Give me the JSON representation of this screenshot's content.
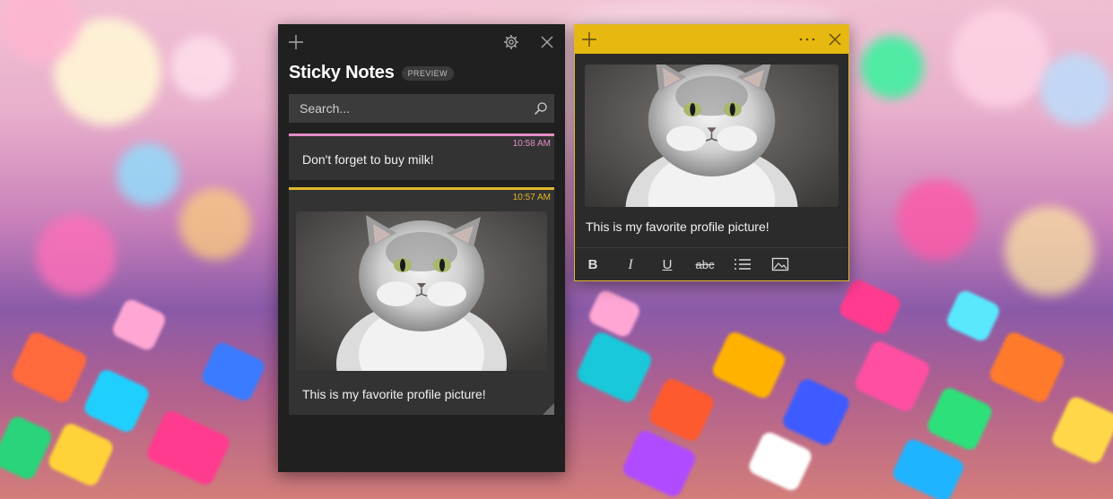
{
  "list_window": {
    "app_title": "Sticky Notes",
    "preview_badge": "PREVIEW",
    "search": {
      "placeholder": "Search..."
    },
    "notes": [
      {
        "time": "10:58 AM",
        "text": "Don't forget to buy milk!",
        "color": "#e58cc6"
      },
      {
        "time": "10:57 AM",
        "text": "This is my favorite profile picture!",
        "color": "#e0b72c",
        "image": "cat-photo"
      }
    ]
  },
  "note_window": {
    "header_color": "#e7b80f",
    "image": "cat-photo",
    "text": "This is my favorite profile picture!",
    "toolbar": {
      "bold": "B",
      "italic": "I",
      "underline": "U",
      "strikethrough": "abc"
    }
  },
  "icons": [
    "plus-icon",
    "gear-icon",
    "close-icon",
    "search-icon",
    "more-icon",
    "list-icon",
    "image-icon"
  ],
  "colors": {
    "window_bg": "#202020",
    "card_bg": "#333333",
    "pink": "#e58cc6",
    "yellow": "#e0b72c"
  }
}
